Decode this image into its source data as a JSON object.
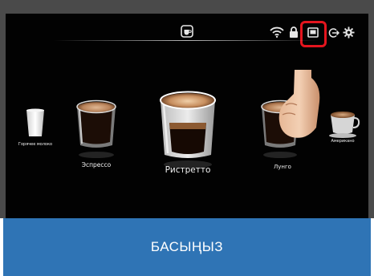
{
  "status_icons": [
    "coffee-cup-icon",
    "wifi-icon",
    "lock-icon",
    "tablet-icon",
    "logout-icon",
    "gear-icon"
  ],
  "highlight_color": "#e4151e",
  "drinks": [
    {
      "label": "Горячее молоко",
      "icon": "milk-glass-icon"
    },
    {
      "label": "Эспрессо",
      "icon": "espresso-cup-icon"
    },
    {
      "label": "Ристретто",
      "icon": "ristretto-cup-icon"
    },
    {
      "label": "Лунго",
      "icon": "lungo-cup-icon"
    },
    {
      "label": "Американо",
      "icon": "americano-cup-icon"
    }
  ],
  "banner": {
    "text": "БАСЫҢЫЗ",
    "color": "#2f74b5"
  }
}
